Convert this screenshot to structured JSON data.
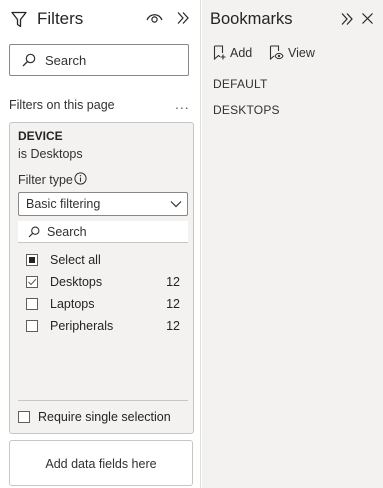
{
  "filters": {
    "title": "Filters",
    "search_placeholder": "Search",
    "section_label": "Filters on this page",
    "more_label": "...",
    "card": {
      "field_name": "DEVICE",
      "condition": "is Desktops",
      "filter_type_label": "Filter type",
      "filter_type_value": "Basic filtering",
      "search_placeholder": "Search",
      "select_all_label": "Select all",
      "options": [
        {
          "label": "Desktops",
          "count": "12",
          "checked": true
        },
        {
          "label": "Laptops",
          "count": "12",
          "checked": false
        },
        {
          "label": "Peripherals",
          "count": "12",
          "checked": false
        }
      ],
      "require_single_label": "Require single selection"
    },
    "add_fields_label": "Add data fields here"
  },
  "bookmarks": {
    "title": "Bookmarks",
    "add_label": "Add",
    "view_label": "View",
    "items": [
      "DEFAULT",
      "DESKTOPS"
    ]
  },
  "icons": {
    "filter": "filter-icon",
    "eye": "eye-icon",
    "collapse": "double-chevron-right-icon",
    "close": "close-icon",
    "search": "search-icon",
    "info": "info-icon",
    "chevron": "chevron-down-icon",
    "add_bookmark": "add-bookmark-icon",
    "view": "view-bookmark-icon"
  },
  "colors": {
    "pane_bg": "#ffffff",
    "bookmarks_bg": "#f3f2f1",
    "card_bg": "#f3f2f1",
    "border": "#c8c6c4",
    "text": "#252423"
  }
}
